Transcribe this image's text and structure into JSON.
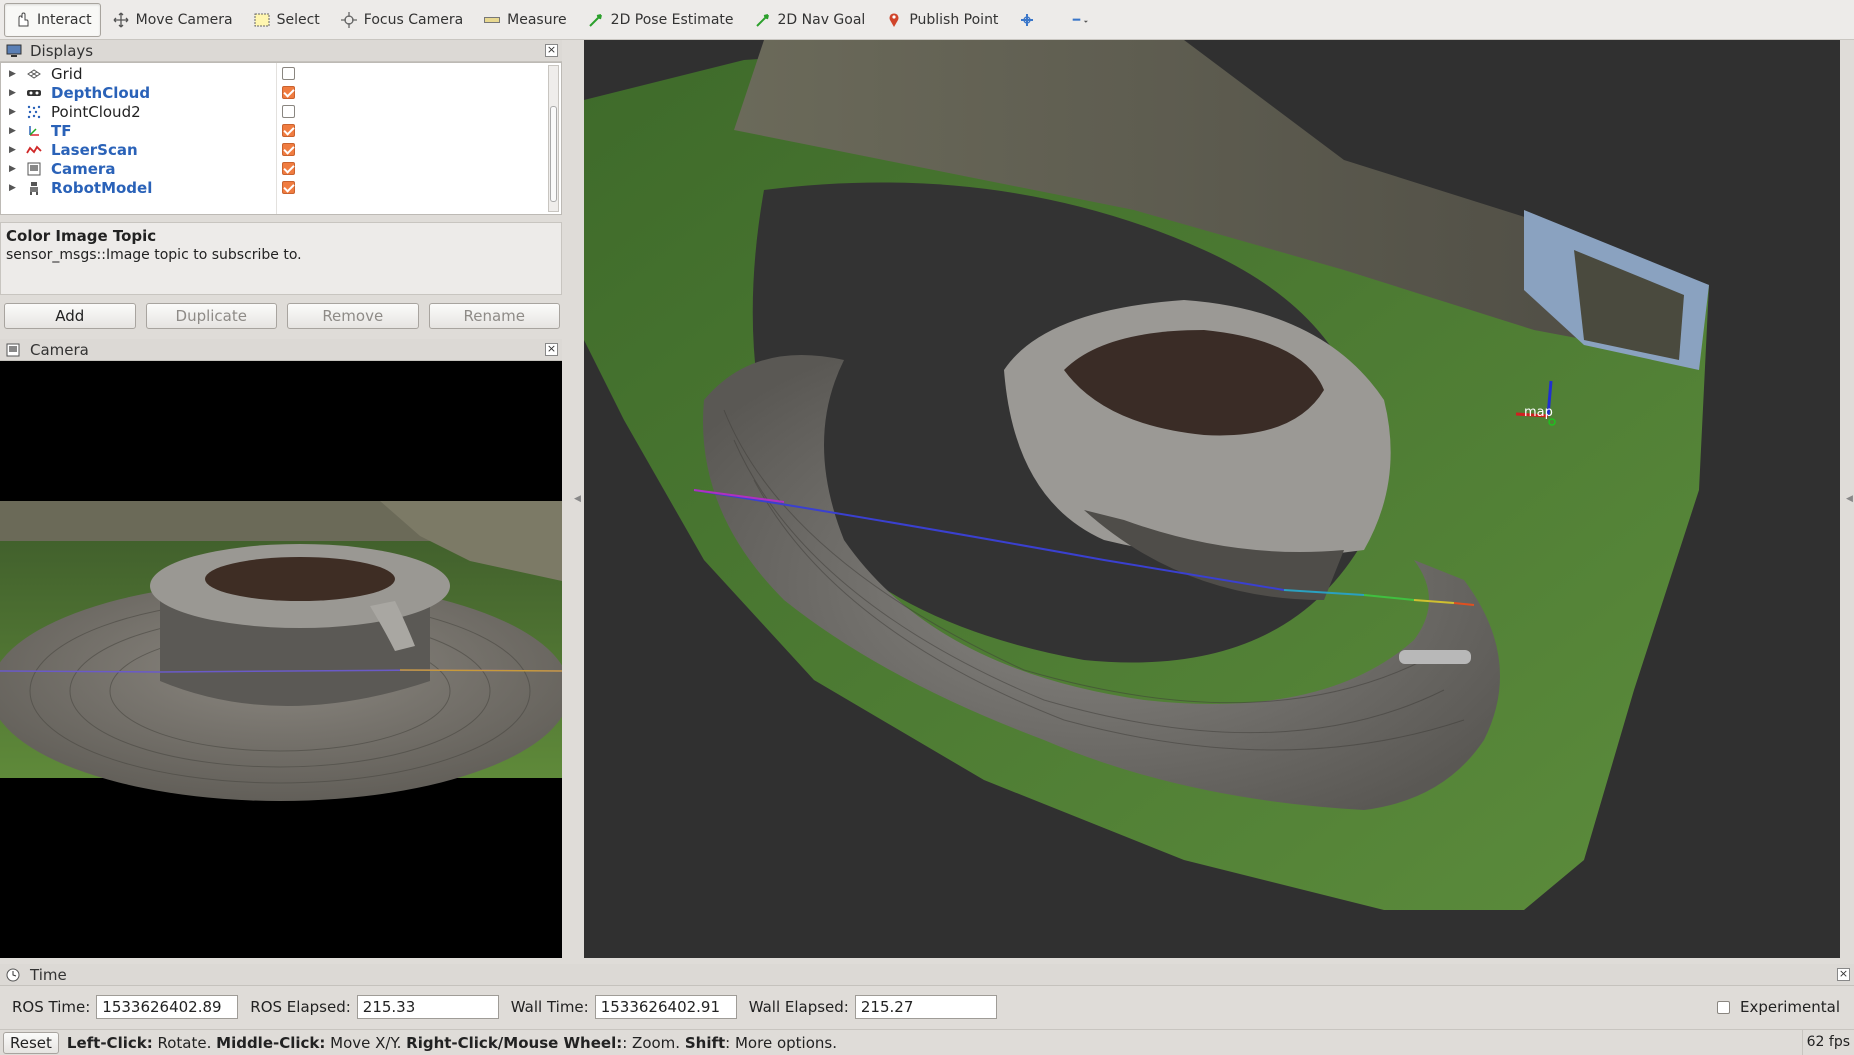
{
  "toolbar": {
    "items": [
      {
        "label": "Interact",
        "icon": "hand-cursor-icon",
        "active": true
      },
      {
        "label": "Move Camera",
        "icon": "move-arrows-icon"
      },
      {
        "label": "Select",
        "icon": "select-rectangle-icon"
      },
      {
        "label": "Focus Camera",
        "icon": "focus-crosshair-icon"
      },
      {
        "label": "Measure",
        "icon": "ruler-icon"
      },
      {
        "label": "2D Pose Estimate",
        "icon": "green-arrow-icon"
      },
      {
        "label": "2D Nav Goal",
        "icon": "green-arrow-icon"
      },
      {
        "label": "Publish Point",
        "icon": "map-pin-icon"
      }
    ]
  },
  "displays": {
    "title": "Displays",
    "items": [
      {
        "name": "Grid",
        "icon": "grid-icon",
        "checked": false,
        "bold": false
      },
      {
        "name": "DepthCloud",
        "icon": "depthcloud-icon",
        "checked": true,
        "bold": true
      },
      {
        "name": "PointCloud2",
        "icon": "pointcloud-icon",
        "checked": false,
        "bold": false
      },
      {
        "name": "TF",
        "icon": "tf-axes-icon",
        "checked": true,
        "bold": true
      },
      {
        "name": "LaserScan",
        "icon": "laserscan-icon",
        "checked": true,
        "bold": true
      },
      {
        "name": "Camera",
        "icon": "camera-icon",
        "checked": true,
        "bold": true
      },
      {
        "name": "RobotModel",
        "icon": "robot-icon",
        "checked": true,
        "bold": true
      }
    ]
  },
  "description": {
    "title": "Color Image Topic",
    "text": "sensor_msgs::Image topic to subscribe to."
  },
  "buttons": {
    "add": "Add",
    "duplicate": "Duplicate",
    "remove": "Remove",
    "rename": "Rename"
  },
  "camera_panel": {
    "title": "Camera"
  },
  "view3d": {
    "frame_label": "map"
  },
  "time_panel": {
    "title": "Time",
    "ros_time_label": "ROS Time:",
    "ros_time": "1533626402.89",
    "ros_elapsed_label": "ROS Elapsed:",
    "ros_elapsed": "215.33",
    "wall_time_label": "Wall Time:",
    "wall_time": "1533626402.91",
    "wall_elapsed_label": "Wall Elapsed:",
    "wall_elapsed": "215.27",
    "experimental_label": "Experimental"
  },
  "statusbar": {
    "reset": "Reset",
    "hint_left_key": "Left-Click:",
    "hint_left": " Rotate. ",
    "hint_middle_key": "Middle-Click:",
    "hint_middle": " Move X/Y. ",
    "hint_right_key": "Right-Click/Mouse Wheel:",
    "hint_right": ": Zoom. ",
    "hint_shift_key": "Shift",
    "hint_shift": ": More options.",
    "fps": "62 fps"
  },
  "colors": {
    "accent_check": "#f07c40",
    "bold_item": "#2a62b8",
    "viewport_bg": "#303030"
  }
}
